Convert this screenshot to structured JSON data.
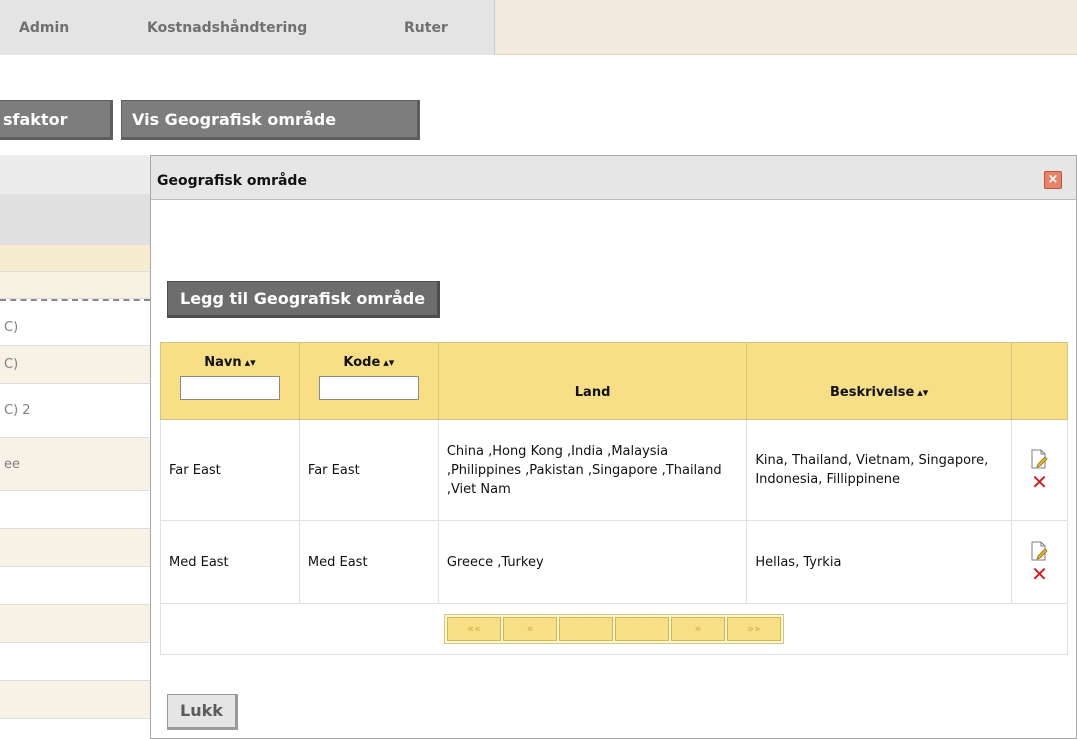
{
  "nav": {
    "admin": "Admin",
    "cost": "Kostnadshåndtering",
    "routes": "Ruter"
  },
  "page": {
    "factor_button": "sfaktor",
    "show_area_button": "Vis Geografisk område"
  },
  "bg_table": {
    "rows": [
      "C)",
      "C)",
      "C) 2",
      "ee"
    ]
  },
  "dialog": {
    "title": "Geografisk område",
    "add_button": "Legg til Geografisk område",
    "close_button": "Lukk",
    "table": {
      "headers": {
        "name": "Navn",
        "code": "Kode",
        "country": "Land",
        "description": "Beskrivelse",
        "sort_icon": "sort-icon"
      },
      "rows": [
        {
          "name": "Far East",
          "code": "Far East",
          "country": "China ,Hong Kong ,India ,Malaysia ,Philippines ,Pakistan ,Singapore ,Thailand ,Viet Nam",
          "description": "Kina, Thailand, Vietnam, Singapore, Indonesia, Fillippinene"
        },
        {
          "name": "Med East",
          "code": "Med East",
          "country": "Greece ,Turkey",
          "description": "Hellas, Tyrkia"
        }
      ],
      "pager": {
        "first": "««",
        "prev": "«",
        "page_a": "",
        "page_b": "",
        "next": "»",
        "last": "»»"
      }
    }
  },
  "colors": {
    "header_bg": "#f8df85",
    "button_bg": "#6d6d6d",
    "delete_icon": "#d11f1f",
    "close_icon": "#e6836a"
  }
}
